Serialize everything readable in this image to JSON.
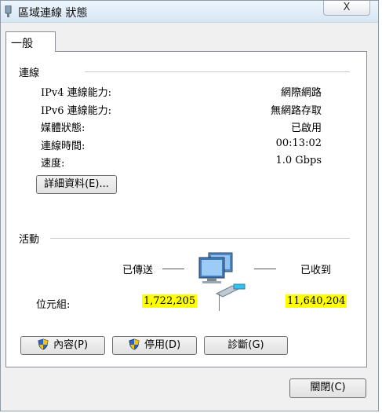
{
  "window": {
    "title": "區域連線 狀態",
    "close_label": "X"
  },
  "tabs": [
    {
      "label": "一般",
      "selected": true
    }
  ],
  "connection": {
    "section_title": "連線",
    "rows": [
      {
        "label": "IPv4 連線能力:",
        "value": "網際網路"
      },
      {
        "label": "IPv6 連線能力:",
        "value": "無網路存取"
      },
      {
        "label": "媒體狀態:",
        "value": "已啟用"
      },
      {
        "label": "連線時間:",
        "value": "00:13:02"
      },
      {
        "label": "速度:",
        "value": "1.0 Gbps"
      }
    ],
    "details_button": "詳細資料(E)..."
  },
  "activity": {
    "section_title": "活動",
    "sent_label": "已傳送",
    "received_label": "已收到",
    "bytes_label": "位元組:",
    "bytes_sent": "1,722,205",
    "bytes_received": "11,640,204",
    "highlight_color": "#ffff00"
  },
  "buttons": {
    "properties": "內容(P)",
    "disable": "停用(D)",
    "diagnose": "診斷(G)",
    "close": "關閉(C)"
  },
  "icons": {
    "title": "network-adapter-icon",
    "activity": "network-computers-icon",
    "shield": "uac-shield-icon"
  }
}
